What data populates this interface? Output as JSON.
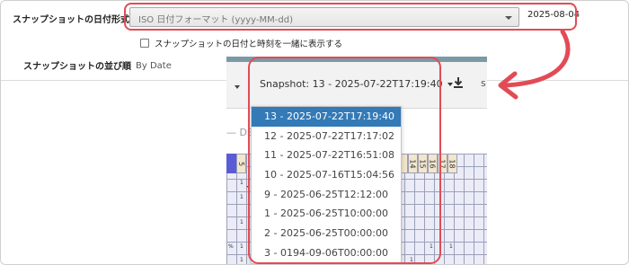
{
  "settings": {
    "date_format_label": "スナップショットの日付形式",
    "date_format_value": "ISO 日付フォーマット (yyyy-MM-dd)",
    "date_preview": "2025-08-04",
    "show_time_label": "スナップショットの日付と時刻を一緒に表示する",
    "sort_label": "スナップショットの並び順",
    "sort_value": "By Date"
  },
  "toolbar": {
    "snapshot_label": "Snapshot: 13 - 2025-07-22T17:19:40",
    "partial_glyph": "s"
  },
  "content": {
    "ds_text": "— DS"
  },
  "grid": {
    "left_header": "5",
    "headers": [
      "",
      "14",
      "15",
      "16",
      "17",
      "18"
    ],
    "cell_values": [
      "1",
      "1",
      "1",
      "%",
      "1",
      "1",
      "1",
      "1",
      "1"
    ]
  },
  "snapshots": [
    "13 - 2025-07-22T17:19:40",
    "12 - 2025-07-22T17:17:02",
    "11 - 2025-07-22T16:51:08",
    "10 - 2025-07-16T15:04:56",
    "9 - 2025-06-25T12:12:00",
    "1 - 2025-06-25T10:00:00",
    "2 - 2025-06-25T00:00:00",
    "3 - 0194-09-06T00:00:00"
  ],
  "selected_snapshot_index": 0,
  "colors": {
    "highlight": "#e24b55",
    "selected_row": "#337ab7"
  },
  "icons": [
    "download-icon",
    "chevron-down-icon",
    "curved-arrow-icon"
  ]
}
